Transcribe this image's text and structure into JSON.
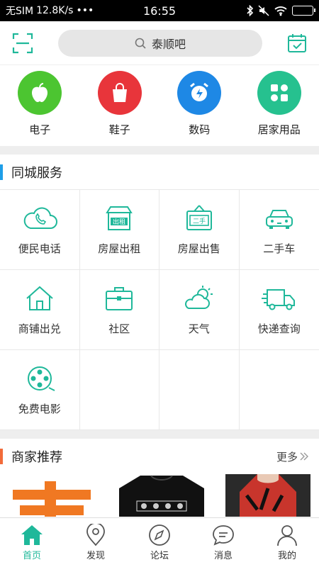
{
  "status": {
    "carrier": "无SIM",
    "speed": "12.8K/s",
    "dots": "•••",
    "time": "16:55"
  },
  "search": {
    "text": "泰顺吧"
  },
  "categories": [
    {
      "label": "电子",
      "color": "#4cc531"
    },
    {
      "label": "鞋子",
      "color": "#e8353b"
    },
    {
      "label": "数码",
      "color": "#1e88e5"
    },
    {
      "label": "居家用品",
      "color": "#26c18f"
    }
  ],
  "services": {
    "title": "同城服务",
    "accent": "#1e9ee8",
    "items": [
      {
        "label": "便民电话"
      },
      {
        "label": "房屋出租",
        "sign": "出租"
      },
      {
        "label": "房屋出售",
        "sign": "二手"
      },
      {
        "label": "二手车"
      },
      {
        "label": "商铺出兑"
      },
      {
        "label": "社区"
      },
      {
        "label": "天气"
      },
      {
        "label": "快递查询"
      },
      {
        "label": "免费电影"
      }
    ]
  },
  "merchants": {
    "title": "商家推荐",
    "accent": "#f26b3a",
    "more": "更多"
  },
  "tabs": [
    {
      "label": "首页"
    },
    {
      "label": "发现"
    },
    {
      "label": "论坛"
    },
    {
      "label": "消息"
    },
    {
      "label": "我的"
    }
  ],
  "theme": {
    "green": "#1fb89a"
  }
}
